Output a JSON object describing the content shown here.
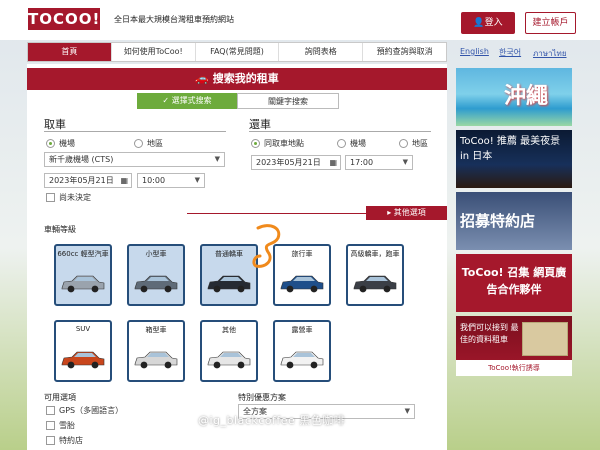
{
  "header": {
    "logo": "TOCOO!",
    "tagline": "全日本最大規模台灣租車預約網站",
    "login": "登入",
    "register": "建立帳戶"
  },
  "nav": {
    "items": [
      "首頁",
      "如何使用ToCoo!",
      "FAQ(常見問題)",
      "詢問表格",
      "預約查詢與取消"
    ],
    "active_index": 0,
    "languages": [
      "English",
      "한국어",
      "ภาษาไทย"
    ]
  },
  "search": {
    "title": "搜索我的租車",
    "tabs": [
      "選擇式搜索",
      "關鍵字搜索"
    ],
    "pickup": {
      "title": "取車",
      "options": [
        "機場",
        "地區"
      ],
      "selected": "機場",
      "location": "新千歲機場 (CTS)",
      "date": "2023年05月21日",
      "time": "10:00",
      "undecided": "尚未決定"
    },
    "dropoff": {
      "title": "還車",
      "options": [
        "同取車地點",
        "機場",
        "地區"
      ],
      "selected": "同取車地點",
      "date": "2023年05月21日",
      "time": "17:00"
    },
    "more_options": "其他選項",
    "car_class_label": "車輛等級",
    "cars": [
      {
        "name": "660cc 輕型汽車",
        "selected": true
      },
      {
        "name": "小型車",
        "selected": true
      },
      {
        "name": "普通轎車",
        "selected": true
      },
      {
        "name": "旅行車",
        "selected": false
      },
      {
        "name": "高級轎車，跑車",
        "selected": false
      },
      {
        "name": "SUV",
        "selected": false
      },
      {
        "name": "箱型車",
        "selected": false
      },
      {
        "name": "其他",
        "selected": false
      },
      {
        "name": "露營車",
        "selected": false
      }
    ],
    "options_label": "可用選項",
    "options": [
      "GPS（多國語言）",
      "雪胎",
      "特約店"
    ],
    "special_label": "特別優惠方案",
    "special_value": "全方案"
  },
  "sidebar": {
    "ads": [
      {
        "text": "沖繩"
      },
      {
        "text": "ToCoo! 推薦 最美夜景 in 日本"
      },
      {
        "text": "招募特約店"
      },
      {
        "text": "ToCoo! 召集 網頁廣告合作夥伴"
      },
      {
        "text": "我們可以接到 最佳的資料租車",
        "footer": "ToCoo!執行誘導"
      }
    ]
  },
  "watermark": "@ig_blackcoffee   黑色咖啡",
  "colors": {
    "brand": "#a5182c",
    "accent": "#6dab3c",
    "car_border": "#264e7a"
  }
}
